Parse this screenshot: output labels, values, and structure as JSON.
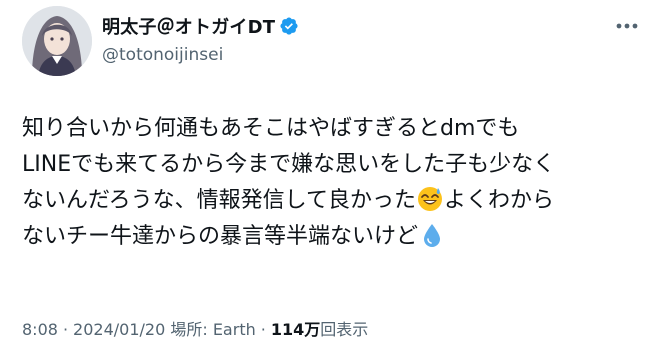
{
  "author": {
    "display_name": "明太子＠オトガイDT",
    "handle": "@totonoijinsei",
    "verified": true,
    "avatar_icon": "avatar-portrait"
  },
  "tweet": {
    "lines": [
      "知り合いから何通もあそこはやばすぎるとdmでも",
      "LINEでも来てるから今まで嫌な思いをした子も少なく",
      "ないんだろうな、情報発信して良かった",
      "よくわから",
      "ないチー牛達からの暴言等半端ないけど"
    ],
    "emojis": [
      "grinning-sweat-emoji",
      "droplet-emoji"
    ]
  },
  "meta": {
    "time": "8:08",
    "date": "2024/01/20",
    "location_label": "場所: Earth",
    "views_count": "114万",
    "views_label": "回表示",
    "separator": "·"
  },
  "colors": {
    "text": "#0f1419",
    "secondary": "#536471",
    "verified": "#1d9bf0"
  },
  "icons": [
    "verified-badge-icon",
    "more-options-icon"
  ]
}
